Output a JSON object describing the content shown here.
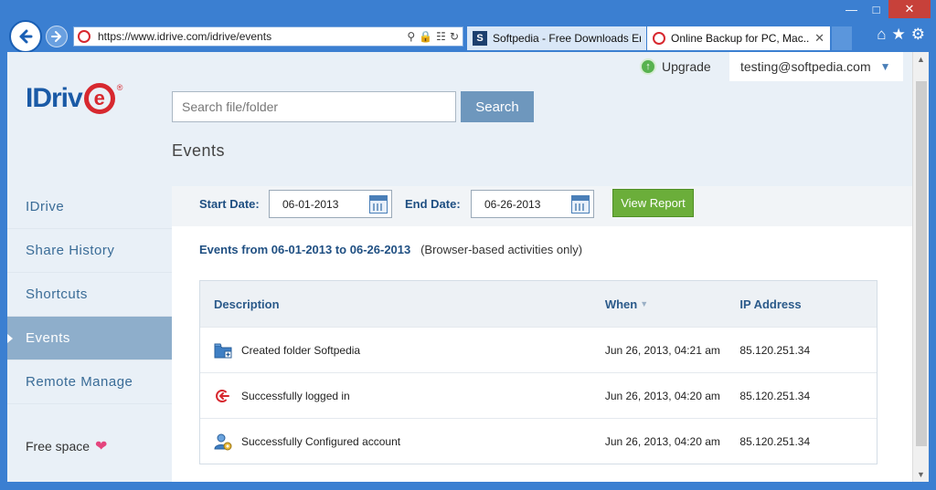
{
  "browser": {
    "address": "https://www.idrive.com/idrive/events",
    "tabs": [
      {
        "label": "Softpedia - Free Downloads En..."
      },
      {
        "label": "Online Backup for PC, Mac..."
      }
    ],
    "icons": [
      "back-icon",
      "forward-icon",
      "search-icon",
      "lock-icon",
      "refresh-icon",
      "home-icon",
      "favorites-icon",
      "settings-icon"
    ]
  },
  "header": {
    "upgrade": "Upgrade",
    "user": "testing@softpedia.com",
    "search_placeholder": "Search file/folder",
    "search_button": "Search",
    "page_title": "Events"
  },
  "sidebar": {
    "logo": "IDriv",
    "logo_e": "e",
    "logo_reg": "®",
    "items": [
      {
        "label": "IDrive"
      },
      {
        "label": "Share History"
      },
      {
        "label": "Shortcuts"
      },
      {
        "label": "Events",
        "active": true
      },
      {
        "label": "Remote Manage"
      }
    ],
    "free_space": "Free space"
  },
  "filters": {
    "start_label": "Start Date:",
    "start_value": "06-01-2013",
    "end_label": "End Date:",
    "end_value": "06-26-2013",
    "report_button": "View Report"
  },
  "events": {
    "range_label": "Events from 06-01-2013 to 06-26-2013",
    "note": "(Browser-based activities only)",
    "columns": {
      "description": "Description",
      "when": "When",
      "ip": "IP Address"
    },
    "rows": [
      {
        "description": "Created folder Softpedia",
        "when": "Jun 26, 2013, 04:21 am",
        "ip": "85.120.251.34",
        "icon": "folder-add-icon"
      },
      {
        "description": "Successfully logged in",
        "when": "Jun 26, 2013, 04:20 am",
        "ip": "85.120.251.34",
        "icon": "login-icon"
      },
      {
        "description": "Successfully Configured account",
        "when": "Jun 26, 2013, 04:20 am",
        "ip": "85.120.251.34",
        "icon": "user-settings-icon"
      }
    ]
  },
  "colors": {
    "brand_blue": "#1a5aa6",
    "brand_red": "#d7282f",
    "accent_green": "#6bae3a",
    "nav_active": "#8eaecb"
  }
}
